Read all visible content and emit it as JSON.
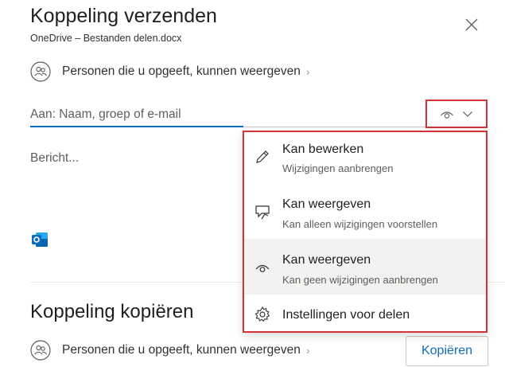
{
  "dialog": {
    "title": "Koppeling verzenden",
    "subtitle": "OneDrive – Bestanden delen.docx",
    "close_icon": "close-icon"
  },
  "share": {
    "permission_text": "Personen die u opgeeft, kunnen weergeven",
    "to_placeholder": "Aan: Naam, groep of e-mail",
    "message_placeholder": "Bericht...",
    "permission_icon": "eye-icon",
    "dropdown_icon": "chevron-down-icon"
  },
  "permission_menu": {
    "items": [
      {
        "icon": "pencil-icon",
        "title": "Kan bewerken",
        "description": "Wijzigingen aanbrengen"
      },
      {
        "icon": "review-icon",
        "title": "Kan weergeven",
        "description": "Kan alleen wijzigingen voorstellen"
      },
      {
        "icon": "eye-icon",
        "title": "Kan weergeven",
        "description": "Kan geen wijzigingen aanbrengen",
        "selected": true
      },
      {
        "icon": "gear-icon",
        "title": "Instellingen voor delen"
      }
    ]
  },
  "copy_link": {
    "title": "Koppeling kopiëren",
    "permission_text": "Personen die u opgeeft, kunnen weergeven",
    "copy_button": "Kopiëren"
  },
  "colors": {
    "accent": "#0f6cbd",
    "highlight_border": "#d13438",
    "selected_bg": "#f3f2f1"
  }
}
